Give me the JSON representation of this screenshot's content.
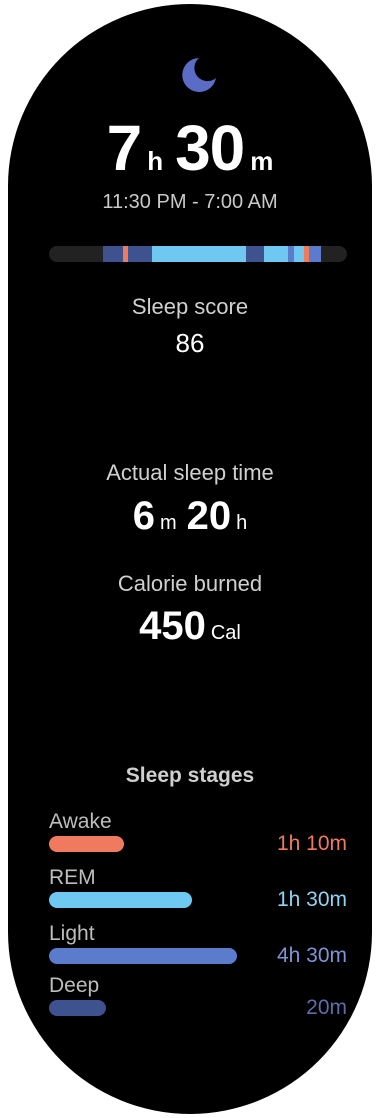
{
  "header": {
    "icon": "moon-icon",
    "icon_color": "#5a6cc6"
  },
  "duration": {
    "hours": "7",
    "hours_unit": "h",
    "minutes": "30",
    "minutes_unit": "m"
  },
  "time_range": "11:30 PM - 7:00 AM",
  "timeline_colors": {
    "awake": "#f07a5e",
    "rem": "#6ec8f2",
    "light": "#5b7ccc",
    "deep": "#3f5290"
  },
  "sleep_score": {
    "label": "Sleep score",
    "value": "86"
  },
  "actual_sleep": {
    "label": "Actual sleep time",
    "value1": "6",
    "unit1": "m",
    "value2": "20",
    "unit2": "h"
  },
  "calories": {
    "label": "Calorie burned",
    "value": "450",
    "unit": "Cal"
  },
  "stages": {
    "title": "Sleep stages",
    "items": [
      {
        "name": "Awake",
        "value": "1h 10m",
        "color": "#f07a5e",
        "value_color": "#f07a5e",
        "fraction": 0.25
      },
      {
        "name": "REM",
        "value": "1h 30m",
        "color": "#6ec8f2",
        "value_color": "#8fd4f5",
        "fraction": 0.48
      },
      {
        "name": "Light",
        "value": "4h 30m",
        "color": "#5b7ccc",
        "value_color": "#7c95d6",
        "fraction": 0.63
      },
      {
        "name": "Deep",
        "value": "20m",
        "color": "#3f5290",
        "value_color": "#5c6ea8",
        "fraction": 0.19
      }
    ]
  }
}
